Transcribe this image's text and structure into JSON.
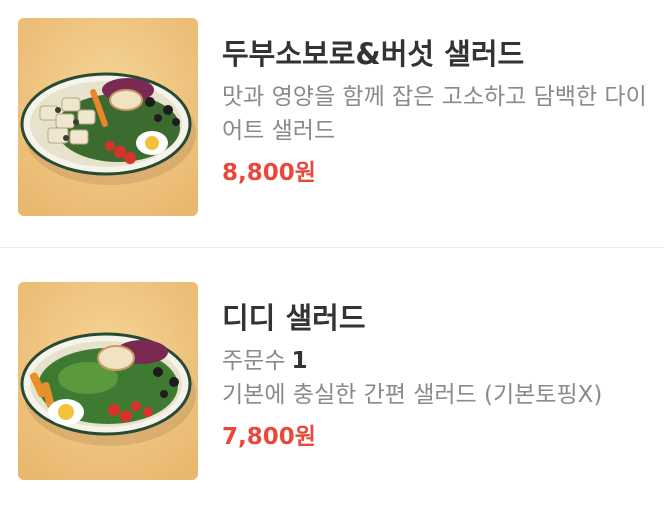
{
  "menu": {
    "items": [
      {
        "name": "두부소보로&버섯 샐러드",
        "description": "맛과 영양을 함께 잡은 고소하고 담백한 다이어트 샐러드",
        "price": "8,800원",
        "image_icon": "salad-photo"
      },
      {
        "name": "디디 샐러드",
        "orders_label": "주문수",
        "orders_count": "1",
        "description": "기본에 충실한 간편 샐러드 (기본토핑X)",
        "price": "7,800원",
        "image_icon": "salad-photo"
      }
    ]
  },
  "colors": {
    "price": "#e8493b",
    "title": "#333333",
    "muted": "#8a8a8a",
    "image_background": "#f1c886"
  }
}
